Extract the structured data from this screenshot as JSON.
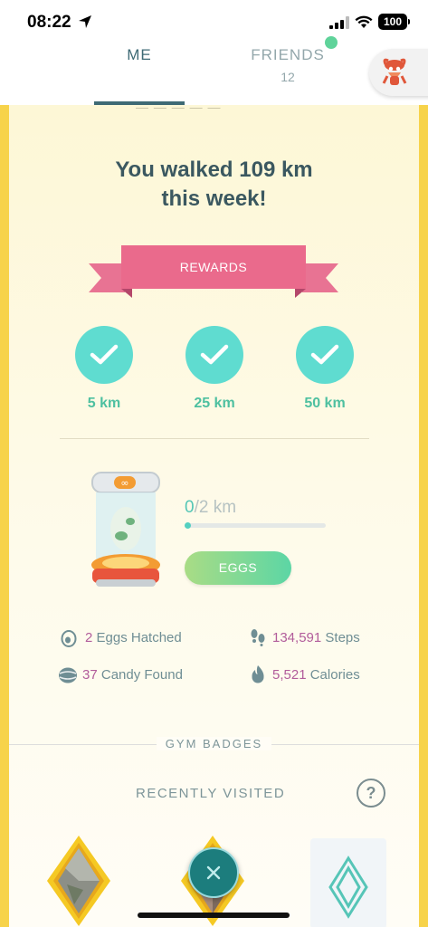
{
  "status_bar": {
    "time": "08:22",
    "battery": "100"
  },
  "tabs": {
    "me_label": "ME",
    "friends_label": "FRIENDS",
    "friends_count": "12"
  },
  "weekly": {
    "headline_line1": "You walked 109 km",
    "headline_line2": "this week!",
    "rewards_label": "REWARDS",
    "milestones": [
      {
        "label": "5 km",
        "completed": true
      },
      {
        "label": "25 km",
        "completed": true
      },
      {
        "label": "50 km",
        "completed": true
      }
    ]
  },
  "incubator": {
    "progress_current": "0",
    "progress_total": "/2 km",
    "progress_fraction": 0.0,
    "eggs_button": "EGGS"
  },
  "stats": {
    "eggs_hatched_num": "2",
    "eggs_hatched_label": " Eggs Hatched",
    "steps_num": "134,591",
    "steps_label": " Steps",
    "candy_num": "37",
    "candy_label": " Candy Found",
    "calories_num": "5,521",
    "calories_label": " Calories"
  },
  "gym": {
    "section_label": "GYM BADGES",
    "recent_label": "RECENTLY VISITED",
    "help_label": "?"
  },
  "colors": {
    "accent_teal": "#5fdcd0",
    "ribbon_pink": "#e56b8a",
    "card_border": "#f7d34a",
    "number_magenta": "#b25d9b"
  }
}
